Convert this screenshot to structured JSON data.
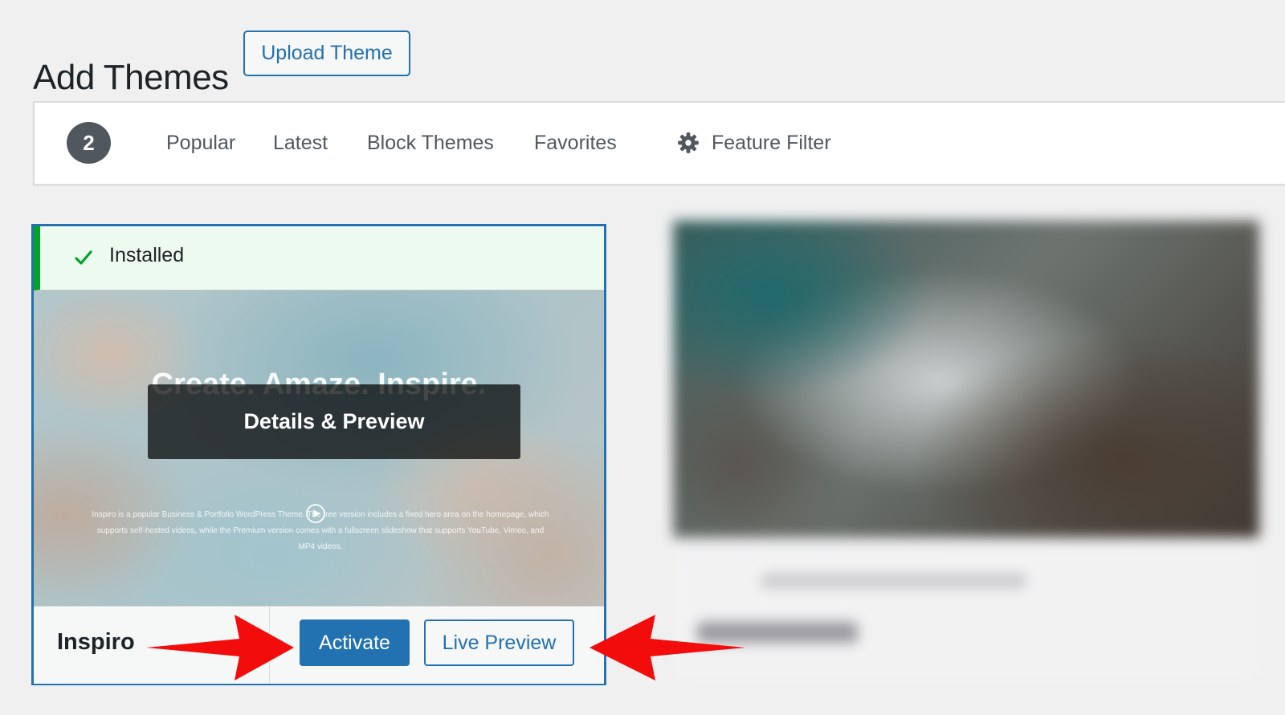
{
  "page": {
    "title": "Add Themes",
    "upload_label": "Upload Theme"
  },
  "filters": {
    "count": "2",
    "tabs": [
      "Popular",
      "Latest",
      "Block Themes",
      "Favorites"
    ],
    "feature_filter_label": "Feature Filter"
  },
  "theme_card": {
    "installed_label": "Installed",
    "hero_title": "Create. Amaze. Inspire.",
    "hero_description": "Inspiro is a popular Business & Portfolio WordPress Theme. The free version includes a fixed hero area on the homepage, which supports self-hosted videos, while the Premium version comes with a fullscreen slideshow that supports YouTube, Vimeo, and MP4 videos.",
    "details_label": "Details & Preview",
    "name": "Inspiro",
    "activate_label": "Activate",
    "live_preview_label": "Live Preview"
  },
  "colors": {
    "accent": "#2271b1",
    "success": "#00a32a",
    "annotation_arrow": "#f20c0c"
  },
  "icons": [
    "gear-icon",
    "checkmark-icon",
    "play-icon",
    "arrow-right-icon",
    "arrow-left-icon"
  ]
}
